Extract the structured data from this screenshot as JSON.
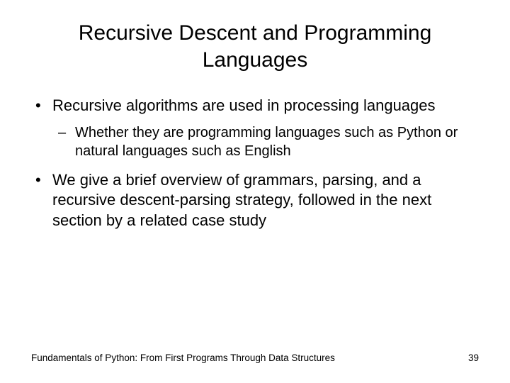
{
  "title": "Recursive Descent and Programming Languages",
  "bullets": {
    "b1": "Recursive algorithms are used in processing languages",
    "b1a": "Whether they are programming languages such as Python or natural languages such as English",
    "b2": "We give a brief overview of grammars, parsing, and a recursive descent-parsing strategy, followed in the next section by a related case study"
  },
  "footer": {
    "source": "Fundamentals of Python: From First Programs Through Data Structures",
    "page": "39"
  }
}
